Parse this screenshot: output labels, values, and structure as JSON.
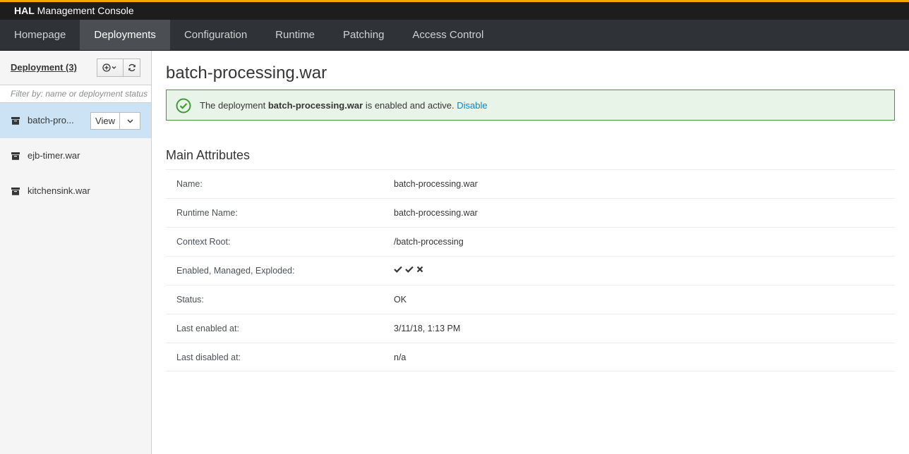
{
  "brand": {
    "bold": "HAL",
    "rest": "Management Console"
  },
  "nav": {
    "items": [
      {
        "label": "Homepage"
      },
      {
        "label": "Deployments"
      },
      {
        "label": "Configuration"
      },
      {
        "label": "Runtime"
      },
      {
        "label": "Patching"
      },
      {
        "label": "Access Control"
      }
    ],
    "active": "Deployments"
  },
  "sidebar": {
    "title": "Deployment (3)",
    "filter_placeholder": "Filter by: name or deployment status",
    "items": [
      {
        "label": "batch-pro...",
        "selected": true
      },
      {
        "label": "ejb-timer.war"
      },
      {
        "label": "kitchensink.war"
      }
    ],
    "view_label": "View"
  },
  "main": {
    "title": "batch-processing.war",
    "alert": {
      "prefix": "The deployment ",
      "name": "batch-processing.war",
      "suffix": " is enabled and active. ",
      "action": "Disable"
    },
    "section_title": "Main Attributes",
    "attributes": [
      {
        "key": "Name:",
        "value": "batch-processing.war"
      },
      {
        "key": "Runtime Name:",
        "value": "batch-processing.war"
      },
      {
        "key": "Context Root:",
        "value": "/batch-processing"
      },
      {
        "key": "Enabled, Managed, Exploded:",
        "value": "",
        "flags": [
          true,
          true,
          false
        ]
      },
      {
        "key": "Status:",
        "value": "OK"
      },
      {
        "key": "Last enabled at:",
        "value": "3/11/18, 1:13 PM"
      },
      {
        "key": "Last disabled at:",
        "value": "n/a"
      }
    ]
  },
  "colors": {
    "accent": "#f0ab00",
    "nav_bg": "#2f3337",
    "nav_active": "#4b4f53",
    "selected_row": "#cbe3f5",
    "success": "#3f9c35",
    "link": "#0088ce"
  }
}
